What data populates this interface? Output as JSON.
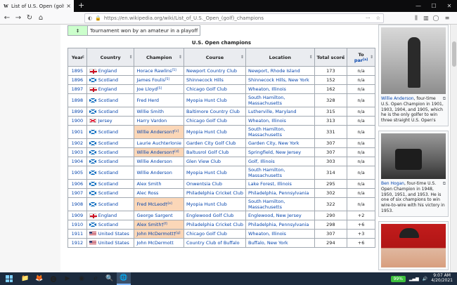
{
  "browser": {
    "tab_title": "List of U.S. Open (golf) champio",
    "tab_favicon": "W",
    "url": "https://en.wikipedia.org/wiki/List_of_U.S._Open_(golf)_champions"
  },
  "legend": {
    "symbol": "‡",
    "text": "Tournament won by an amateur in a playoff"
  },
  "table": {
    "caption": "U.S. Open champions",
    "headers": [
      "Year",
      "Country",
      "Champion",
      "Course",
      "Location",
      "Total score",
      "To par"
    ],
    "to_par_label": "To",
    "to_par_link": "par",
    "to_par_ref": "[a]",
    "rows": [
      {
        "year": "1895",
        "flag": "england",
        "country": "England",
        "champion": "Horace Rawlins",
        "ref": "[5]",
        "course": "Newport Country Club",
        "location": "Newport, Rhode Island",
        "score": "173",
        "par": "n/a",
        "amateur": false
      },
      {
        "year": "1896",
        "flag": "scotland",
        "country": "Scotland",
        "champion": "James Foulis",
        "ref": "[5]",
        "course": "Shinnecock Hills",
        "location": "Shinnecock Hills, New York",
        "score": "152",
        "par": "n/a",
        "amateur": false
      },
      {
        "year": "1897",
        "flag": "england",
        "country": "England",
        "champion": "Joe Lloyd",
        "ref": "[5]",
        "course": "Chicago Golf Club",
        "location": "Wheaton, Illinois",
        "score": "162",
        "par": "n/a",
        "amateur": false
      },
      {
        "year": "1898",
        "flag": "scotland",
        "country": "Scotland",
        "champion": "Fred Herd",
        "ref": "",
        "course": "Myopia Hunt Club",
        "location": "South Hamilton, Massachusetts",
        "score": "328",
        "par": "n/a",
        "amateur": false
      },
      {
        "year": "1899",
        "flag": "scotland",
        "country": "Scotland",
        "champion": "Willie Smith",
        "ref": "",
        "course": "Baltimore Country Club",
        "location": "Lutherville, Maryland",
        "score": "315",
        "par": "n/a",
        "amateur": false
      },
      {
        "year": "1900",
        "flag": "jersey",
        "country": "Jersey",
        "champion": "Harry Vardon",
        "ref": "",
        "course": "Chicago Golf Club",
        "location": "Wheaton, Illinois",
        "score": "313",
        "par": "n/a",
        "amateur": false
      },
      {
        "year": "1901",
        "flag": "scotland",
        "country": "Scotland",
        "champion": "Willie Anderson†",
        "ref": "[c]",
        "course": "Myopia Hunt Club",
        "location": "South Hamilton, Massachusetts",
        "score": "331",
        "par": "n/a",
        "amateur": true
      },
      {
        "year": "1902",
        "flag": "scotland",
        "country": "Scotland",
        "champion": "Laurie Auchterlonie",
        "ref": "",
        "course": "Garden City Golf Club",
        "location": "Garden City, New York",
        "score": "307",
        "par": "n/a",
        "amateur": false
      },
      {
        "year": "1903",
        "flag": "scotland",
        "country": "Scotland",
        "champion": "Willie Anderson†",
        "ref": "[d]",
        "course": "Baltusrol Golf Club",
        "location": "Springfield, New Jersey",
        "score": "307",
        "par": "n/a",
        "amateur": true
      },
      {
        "year": "1904",
        "flag": "scotland",
        "country": "Scotland",
        "champion": "Willie Anderson",
        "ref": "",
        "course": "Glen View Club",
        "location": "Golf, Illinois",
        "score": "303",
        "par": "n/a",
        "amateur": false
      },
      {
        "year": "1905",
        "flag": "scotland",
        "country": "Scotland",
        "champion": "Willie Anderson",
        "ref": "",
        "course": "Myopia Hunt Club",
        "location": "South Hamilton, Massachusetts",
        "score": "314",
        "par": "n/a",
        "amateur": false
      },
      {
        "year": "1906",
        "flag": "scotland",
        "country": "Scotland",
        "champion": "Alex Smith",
        "ref": "",
        "course": "Onwentsia Club",
        "location": "Lake Forest, Illinois",
        "score": "295",
        "par": "n/a",
        "amateur": false
      },
      {
        "year": "1907",
        "flag": "scotland",
        "country": "Scotland",
        "champion": "Alec Ross",
        "ref": "",
        "course": "Philadelphia Cricket Club",
        "location": "Philadelphia, Pennsylvania",
        "score": "302",
        "par": "n/a",
        "amateur": false
      },
      {
        "year": "1908",
        "flag": "scotland",
        "country": "Scotland",
        "champion": "Fred McLeod†",
        "ref": "[e]",
        "course": "Myopia Hunt Club",
        "location": "South Hamilton, Massachusetts",
        "score": "322",
        "par": "n/a",
        "amateur": true
      },
      {
        "year": "1909",
        "flag": "england",
        "country": "England",
        "champion": "George Sargent",
        "ref": "",
        "course": "Englewood Golf Club",
        "location": "Englewood, New Jersey",
        "score": "290",
        "par": "+2",
        "amateur": false
      },
      {
        "year": "1910",
        "flag": "scotland",
        "country": "Scotland",
        "champion": "Alex Smith†",
        "ref": "[f]",
        "course": "Philadelphia Cricket Club",
        "location": "Philadelphia, Pennsylvania",
        "score": "298",
        "par": "+6",
        "amateur": true
      },
      {
        "year": "1911",
        "flag": "us",
        "country": "United States",
        "champion": "John McDermott†",
        "ref": "[g]",
        "course": "Chicago Golf Club",
        "location": "Wheaton, Illinois",
        "score": "307",
        "par": "+3",
        "amateur": true
      },
      {
        "year": "1912",
        "flag": "us",
        "country": "United States",
        "champion": "John McDermott",
        "ref": "",
        "course": "Country Club of Buffalo",
        "location": "Buffalo, New York",
        "score": "294",
        "par": "+6",
        "amateur": false
      }
    ]
  },
  "sidebar": {
    "images": [
      {
        "icon": "photo-willie-anderson",
        "caption_link": "Willie Anderson",
        "caption_rest": ", four-time U.S. Open Champion in 1901, 1903, 1904, and 1905, which he is the only golfer to win three straight U.S. Open's"
      },
      {
        "icon": "photo-ben-hogan",
        "caption_link": "Ben Hogan",
        "caption_rest": ", four-time U.S. Open Champion in 1948, 1950, 1951, and 1953. He is one of six champions to win wire-to-wire with his victory in 1953."
      },
      {
        "icon": "photo-jack-nicklaus",
        "caption_link": "",
        "caption_rest": ""
      }
    ]
  },
  "taskbar": {
    "battery": "99%",
    "time": "9:07 AM",
    "date": "4/20/2021"
  }
}
